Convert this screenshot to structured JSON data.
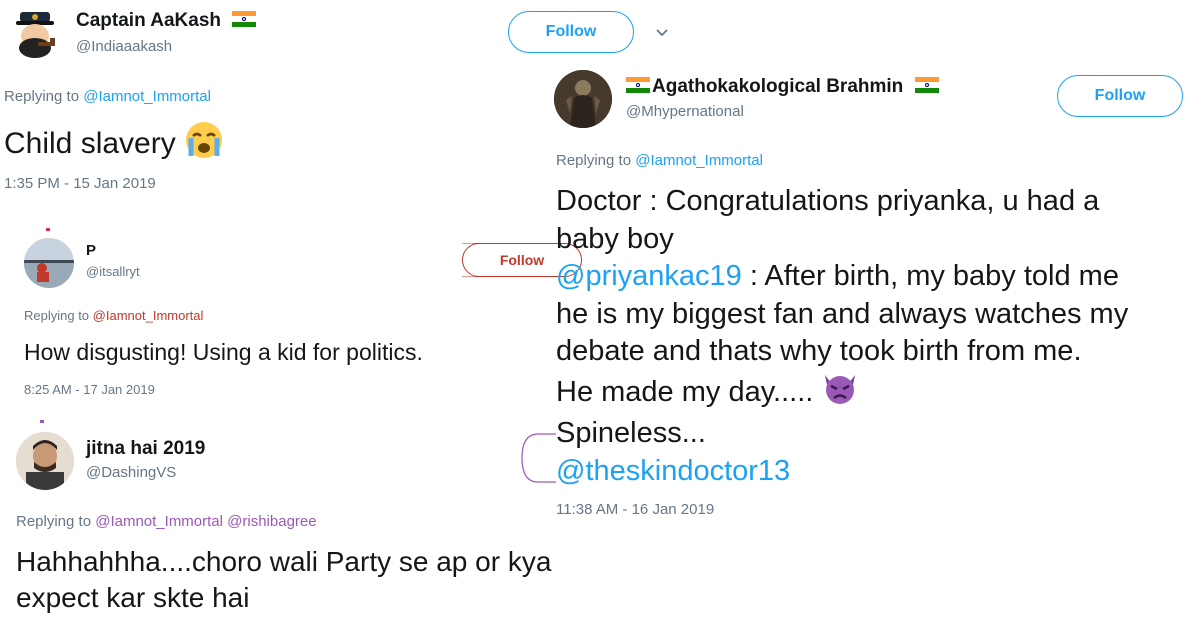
{
  "tweet1": {
    "name": "Captain AaKash",
    "handle": "@Indiaaakash",
    "follow_label": "Follow",
    "replying_prefix": "Replying to",
    "replying_to": "@Iamnot_Immortal",
    "text": "Child slavery",
    "emoji": "crying-face",
    "timestamp": "1:35 PM - 15 Jan 2019"
  },
  "tweet2": {
    "name": "P",
    "handle": "@itsallryt",
    "follow_label": "Follow",
    "replying_prefix": "Replying to",
    "replying_to": "@Iamnot_Immortal",
    "text": "How disgusting! Using a kid for politics.",
    "timestamp": "8:25 AM - 17 Jan 2019"
  },
  "tweet3": {
    "name": "jitna hai 2019",
    "handle": "@DashingVS",
    "replying_prefix": "Replying to",
    "replying_to_1": "@Iamnot_Immortal",
    "replying_to_2": "@rishibagree",
    "text_line1": "Hahhahhha....choro wali Party se ap or kya",
    "text_line2": "expect kar skte hai"
  },
  "tweet4": {
    "name": "Agathokakological Brahmin",
    "handle": "@Mhypernational",
    "follow_label": "Follow",
    "replying_prefix": "Replying to",
    "replying_to": "@Iamnot_Immortal",
    "line1": "Doctor : Congratulations priyanka, u had a",
    "line2": "baby boy",
    "mention1": "@priyankac19",
    "line3_rest": " : After birth, my baby told me",
    "line4": "he is my biggest fan and always watches my",
    "line5": "debate and thats why took birth from me.",
    "line6": "He made my day.....",
    "emoji": "angry-devil",
    "line7": "Spineless...",
    "mention2": "@theskindoctor13",
    "timestamp": "11:38 AM - 16 Jan 2019"
  },
  "colors": {
    "link": "#1da1f2",
    "muted": "#657786",
    "text": "#14171a",
    "follow_border_p": "#c0392b",
    "bracket": "#9b59b6"
  }
}
